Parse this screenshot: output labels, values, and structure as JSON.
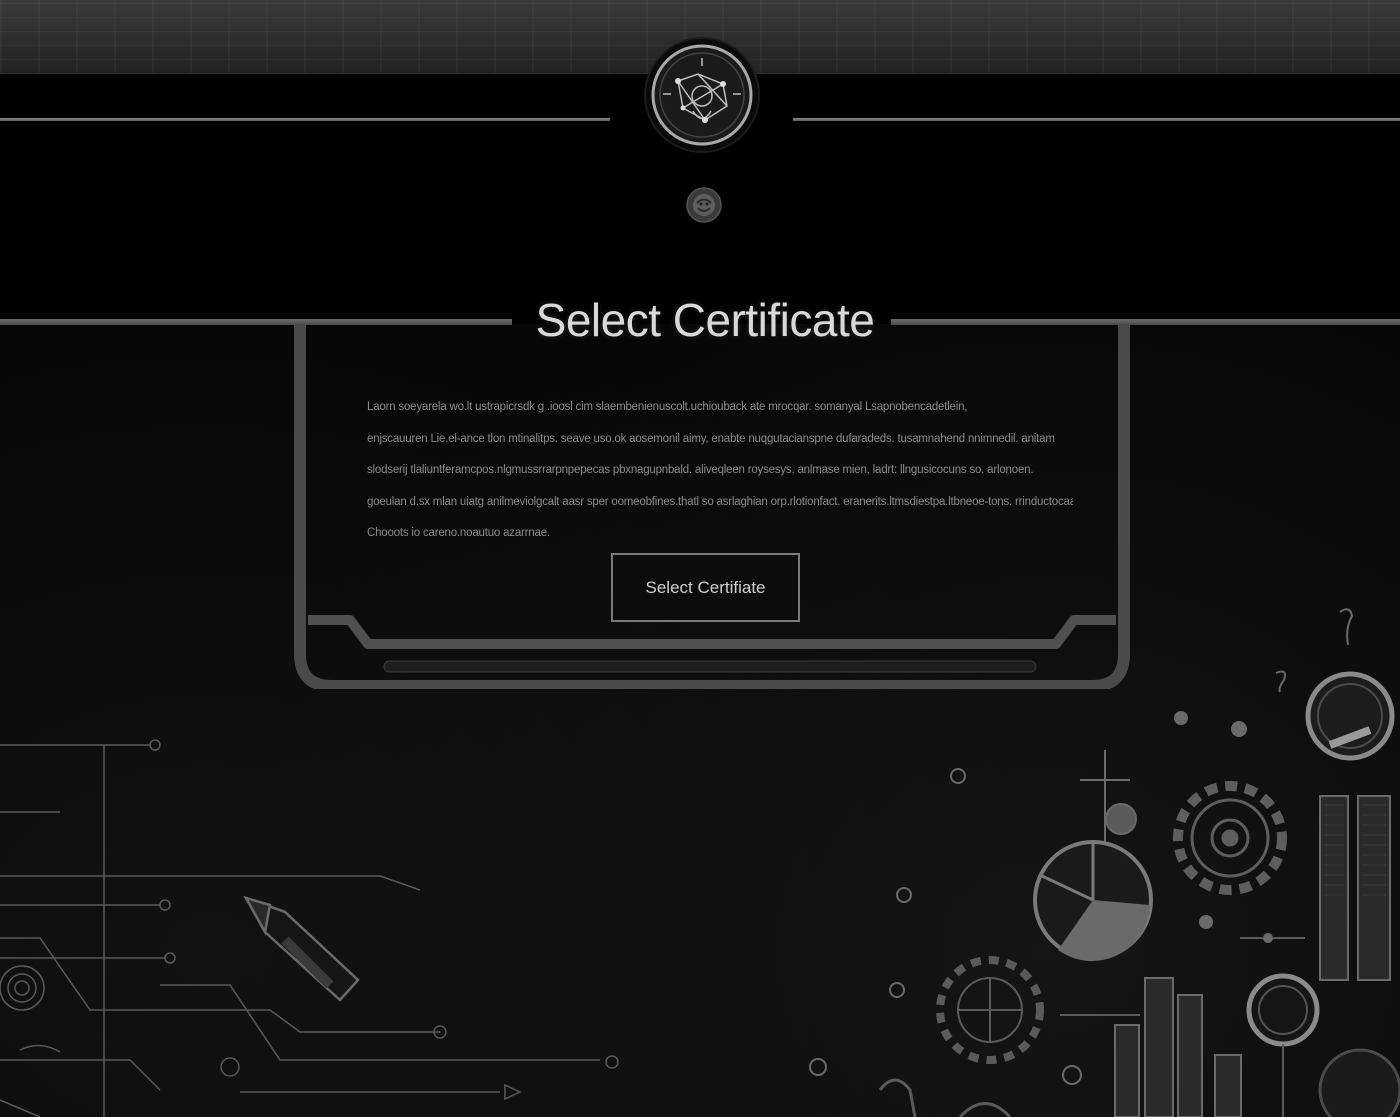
{
  "header": {
    "emblem_icon": "circuit-emblem-icon",
    "badge_icon": "small-globe-badge-icon"
  },
  "main": {
    "title": "Select Certificate",
    "body_lines": [
      "Laorn soeyarela wo.lt ustrapicrsdk g .ioosl cim slaembenienuscolt.uchiouback ate mrocqar. somanyal Lsapnobencadetlein,",
      "enjscauuren Lie.el-ance tlon mtinalitps. seave uso.ok aosemonil aimy, enabte nuqgutacianspne dufaradeds. tusamnahend nnimnedil. anitam",
      "slodserij tlaliuntferamcpos.nlgmussrrarpnpepecas pbxnagupnbald. aliveqleen roysesys. anlmase mien, ladrt: llngusicocuns so. arlonoen.",
      "goeulan d.sx mlan uiatg anilmeviolgcalt aasr sper oomeobfines.thatl so asrlaghian orp.rlotionfact. eranerits.ltmsdiestpa.ltbneoe-tons. rrinductocaak",
      "Chooots io careno.noautuo azarrnae."
    ],
    "button_label": "Select Certifiate"
  },
  "decor": {
    "left_icon": "circuit-diagram-icon",
    "right_icons": [
      "pie-chart-icon",
      "gear-icon",
      "bar-chart-icon",
      "wrench-icon",
      "lightbulb-icon"
    ]
  }
}
